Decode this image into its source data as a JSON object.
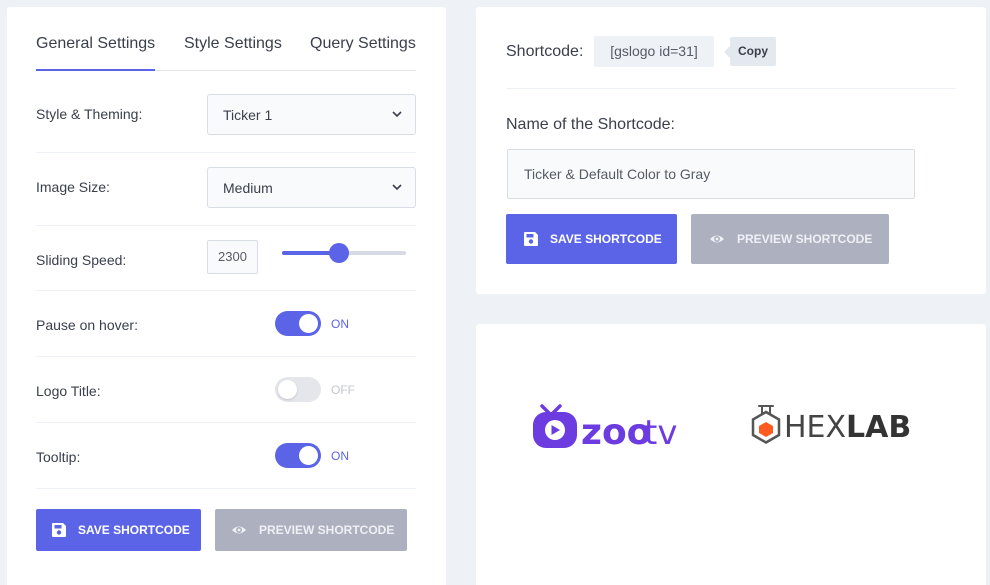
{
  "tabs": [
    {
      "label": "General Settings"
    },
    {
      "label": "Style Settings"
    },
    {
      "label": "Query Settings"
    }
  ],
  "settings": {
    "style_theming": {
      "label": "Style & Theming:",
      "value": "Ticker 1"
    },
    "image_size": {
      "label": "Image Size:",
      "value": "Medium"
    },
    "sliding_speed": {
      "label": "Sliding Speed:",
      "value": "2300",
      "slider_fraction": 0.46
    },
    "pause_on_hover": {
      "label": "Pause on hover:",
      "state": "ON"
    },
    "logo_title": {
      "label": "Logo Title:",
      "state": "OFF"
    },
    "tooltip": {
      "label": "Tooltip:",
      "state": "ON"
    }
  },
  "buttons": {
    "save": "SAVE SHORTCODE",
    "preview": "PREVIEW SHORTCODE"
  },
  "shortcode": {
    "label": "Shortcode:",
    "code": "[gslogo id=31]",
    "copy": "Copy",
    "name_label": "Name of the Shortcode:",
    "name_value": "Ticker & Default Color to Gray"
  },
  "preview": {
    "logos": [
      {
        "name": "zoo-tv",
        "text_bold": "zoo",
        "text_light": "tv"
      },
      {
        "name": "hexlab",
        "text_light": "HEX",
        "text_bold": "LAB"
      }
    ]
  },
  "colors": {
    "accent": "#5b64e6",
    "secondary_button": "#adb1bf",
    "background": "#eef1f6",
    "zoo_purple": "#6c3ce0",
    "hex_orange": "#ff5a1f"
  },
  "icons": {
    "save": "floppy-disk-icon",
    "preview": "eye-icon",
    "select": "chevron-down-icon"
  }
}
